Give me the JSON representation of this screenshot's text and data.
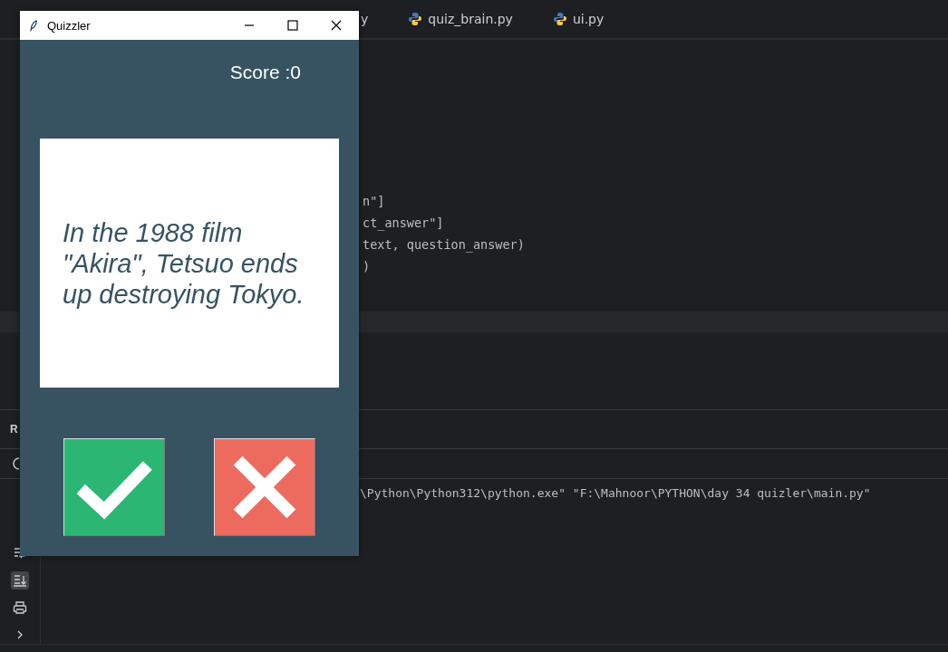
{
  "ide": {
    "tabs": [
      {
        "label": "y",
        "selected": false
      },
      {
        "label": "quiz_brain.py",
        "selected": false
      },
      {
        "label": "ui.py",
        "selected": false
      }
    ],
    "code_lines": [
      "n\"]",
      "ct_answer\"]",
      "text, question_answer)",
      ")"
    ],
    "run_panel": {
      "title": "R",
      "console_lines": [
        "\\Python\\Python312\\python.exe\" \"F:\\Mahnoor\\PYTHON\\day 34 quizler\\main.py\""
      ]
    }
  },
  "quiz_window": {
    "title": "Quizzler",
    "score": "Score :0",
    "question": "In the 1988 film \"Akira\", Tetsuo ends up destroying Tokyo.",
    "buttons": [
      {
        "kind": "true"
      },
      {
        "kind": "false"
      }
    ]
  }
}
